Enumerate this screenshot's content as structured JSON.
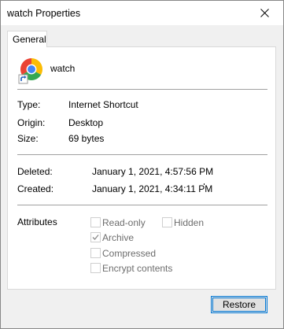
{
  "window": {
    "title": "watch Properties"
  },
  "tabs": [
    {
      "label": "General",
      "selected": true
    }
  ],
  "file": {
    "name": "watch",
    "icon": "chrome-shortcut-icon"
  },
  "details": {
    "type_label": "Type:",
    "type_value": "Internet Shortcut",
    "origin_label": "Origin:",
    "origin_value": "Desktop",
    "size_label": "Size:",
    "size_value": "69 bytes"
  },
  "dates": {
    "deleted_label": "Deleted:",
    "deleted_value": "January 1, 2021, 4:57:56 PM",
    "created_label": "Created:",
    "created_value": "January 1, 2021, 4:34:11 PM"
  },
  "attributes": {
    "label": "Attributes",
    "items": [
      {
        "label": "Read-only",
        "checked": false,
        "enabled": false
      },
      {
        "label": "Hidden",
        "checked": false,
        "enabled": false
      },
      {
        "label": "Archive",
        "checked": true,
        "enabled": false
      },
      {
        "label": "Compressed",
        "checked": false,
        "enabled": false
      },
      {
        "label": "Encrypt contents",
        "checked": false,
        "enabled": false
      }
    ]
  },
  "buttons": {
    "restore_label": "Restore"
  },
  "colors": {
    "focus_border": "#0078d7",
    "disabled_text": "#6d6d6d",
    "divider": "#a0a0a0"
  }
}
